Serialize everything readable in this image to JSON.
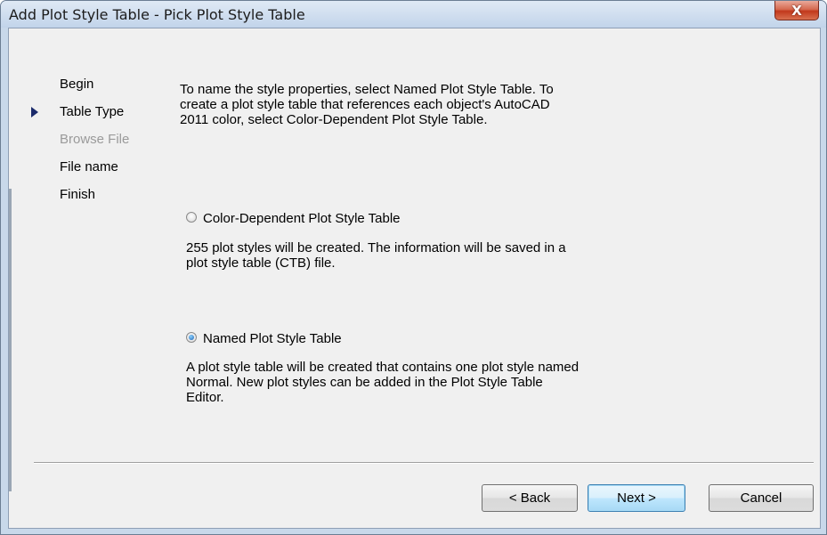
{
  "window": {
    "title": "Add Plot Style Table - Pick Plot Style Table",
    "close_label": "X"
  },
  "steps": [
    {
      "label": "Begin",
      "current": false,
      "disabled": false
    },
    {
      "label": "Table Type",
      "current": true,
      "disabled": false
    },
    {
      "label": "Browse File",
      "current": false,
      "disabled": true
    },
    {
      "label": "File name",
      "current": false,
      "disabled": false
    },
    {
      "label": "Finish",
      "current": false,
      "disabled": false
    }
  ],
  "description": {
    "line1": "To name the style properties, select Named Plot Style Table. To",
    "line2": "create a plot style table that references each object's AutoCAD",
    "line3": "2011 color, select Color-Dependent Plot Style Table."
  },
  "options": {
    "color_dependent": {
      "label": "Color-Dependent Plot Style Table",
      "checked": false,
      "desc_line1": "255 plot styles will be created. The information will be saved in a",
      "desc_line2": "plot style table (CTB) file."
    },
    "named": {
      "label": "Named Plot Style Table",
      "checked": true,
      "desc_line1": "A plot style table will be created that contains one plot style named",
      "desc_line2": "Normal.  New plot styles can be added in the Plot Style Table",
      "desc_line3": "Editor."
    }
  },
  "buttons": {
    "back": "< Back",
    "next": "Next >",
    "cancel": "Cancel"
  },
  "colors": {
    "step_arrow": "#1a2a6a",
    "disabled_text": "#9a9a9a",
    "close_button": "#c2381c"
  }
}
